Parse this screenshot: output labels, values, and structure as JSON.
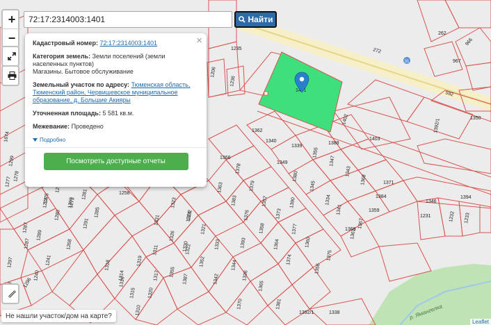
{
  "search": {
    "value": "72:17:2314003:1401",
    "button_label": "Найти"
  },
  "controls": {
    "zoom_in": "+",
    "zoom_out": "−"
  },
  "popup": {
    "cadastral_label": "Кадастровый номер:",
    "cadastral_value": "72:17:2314003:1401",
    "category_label": "Категория земель:",
    "category_value_1": "Земли поселений (земли",
    "category_value_2": "населенных пунктов)",
    "usage": "Магазины. Бытовое обслуживание",
    "address_label": "Земельный участок по адресу:",
    "address_1": "Тюменская область,",
    "address_2": "Тюменский район, Червишевское муниципальное",
    "address_3": "образование, д. Большие Акияры",
    "area_label": "Уточненная площадь:",
    "area_value": "5 581 кв.м.",
    "survey_label": "Межевание:",
    "survey_value": "Проведено",
    "more_label": "Подробно",
    "report_button": "Посмотреть доступные отчеты",
    "close": "×"
  },
  "map": {
    "selected_parcel_label": "1401",
    "road_name": "р. Ямангелка",
    "road_number": "31",
    "parcel_labels": [
      "1235",
      "1206",
      "1236",
      "272",
      "262",
      "966",
      "967",
      "592",
      "1350",
      "1392/1",
      "1402",
      "1403",
      "1362",
      "1340",
      "1339",
      "1355",
      "1349",
      "1347",
      "1388",
      "1366",
      "1378",
      "1379",
      "1380",
      "1345",
      "1343",
      "1368",
      "1384",
      "1371",
      "1394",
      "1363",
      "1383",
      "1357",
      "1334",
      "1341",
      "1359",
      "1346",
      "1232",
      "1233",
      "1231",
      "1326",
      "1323",
      "1331",
      "1324",
      "1321",
      "1322",
      "1376",
      "1373",
      "1330",
      "1358",
      "1333",
      "1393",
      "1364",
      "1390",
      "1377",
      "1360",
      "1367",
      "1369",
      "1361",
      "1332",
      "1352",
      "1344",
      "1374",
      "1356",
      "1375",
      "1387",
      "1336",
      "1342",
      "1365",
      "1311",
      "1314",
      "1315",
      "1320",
      "1317",
      "1310",
      "1355",
      "1319",
      "1318",
      "1316",
      "1370",
      "1381",
      "1392/1",
      "1338",
      "1258",
      "1285",
      "1281",
      "1291",
      "1275",
      "1274",
      "1280",
      "1272",
      "1273",
      "1269",
      "1268",
      "1287",
      "1289",
      "1297",
      "1241",
      "1240",
      "1296",
      "1298",
      "1274",
      "1674",
      "1278",
      "1299",
      "1277",
      "1287"
    ],
    "attribution": "Leaflet"
  },
  "notfound": "Не нашли участок/дом на карте?",
  "colors": {
    "parcel_line": "#d9534f",
    "selected_fill": "#3de07a",
    "forest": "#bfe3b4",
    "road": "#f6efc8",
    "button_blue": "#2d6aa8",
    "report_green": "#4cae4c",
    "pin": "#2a81cb"
  }
}
